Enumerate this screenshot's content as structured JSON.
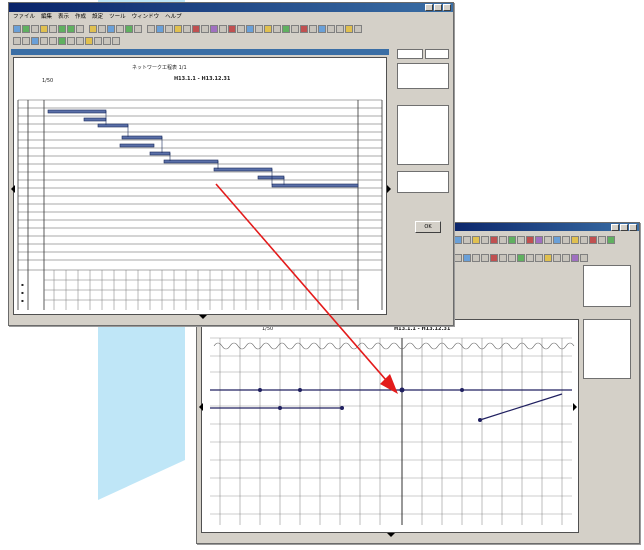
{
  "colors": {
    "background_shape": "#bfe6f7",
    "title_bar": "#0a246a",
    "pointer_arrow": "#e31b1b",
    "task_bar": "#5a6fa8",
    "window_face": "#d4d0c8"
  },
  "front_window": {
    "menu_items": [
      "ファイル",
      "編集",
      "表示",
      "作成",
      "設定",
      "ツール",
      "ウィンドウ",
      "ヘルプ"
    ],
    "chart_title": "ネットワーク工程表 1/1",
    "zoom_label": "1/50",
    "date_range": "H13.1.1 - H13.12.31",
    "side_button": "OK"
  },
  "back_window": {
    "zoom_label": "1/50",
    "date_range": "H13.1.1 - H13.12.31"
  },
  "icons": [
    "scroll-left-icon",
    "scroll-right-icon",
    "scroll-down-icon",
    "pointer-arrow-icon"
  ]
}
